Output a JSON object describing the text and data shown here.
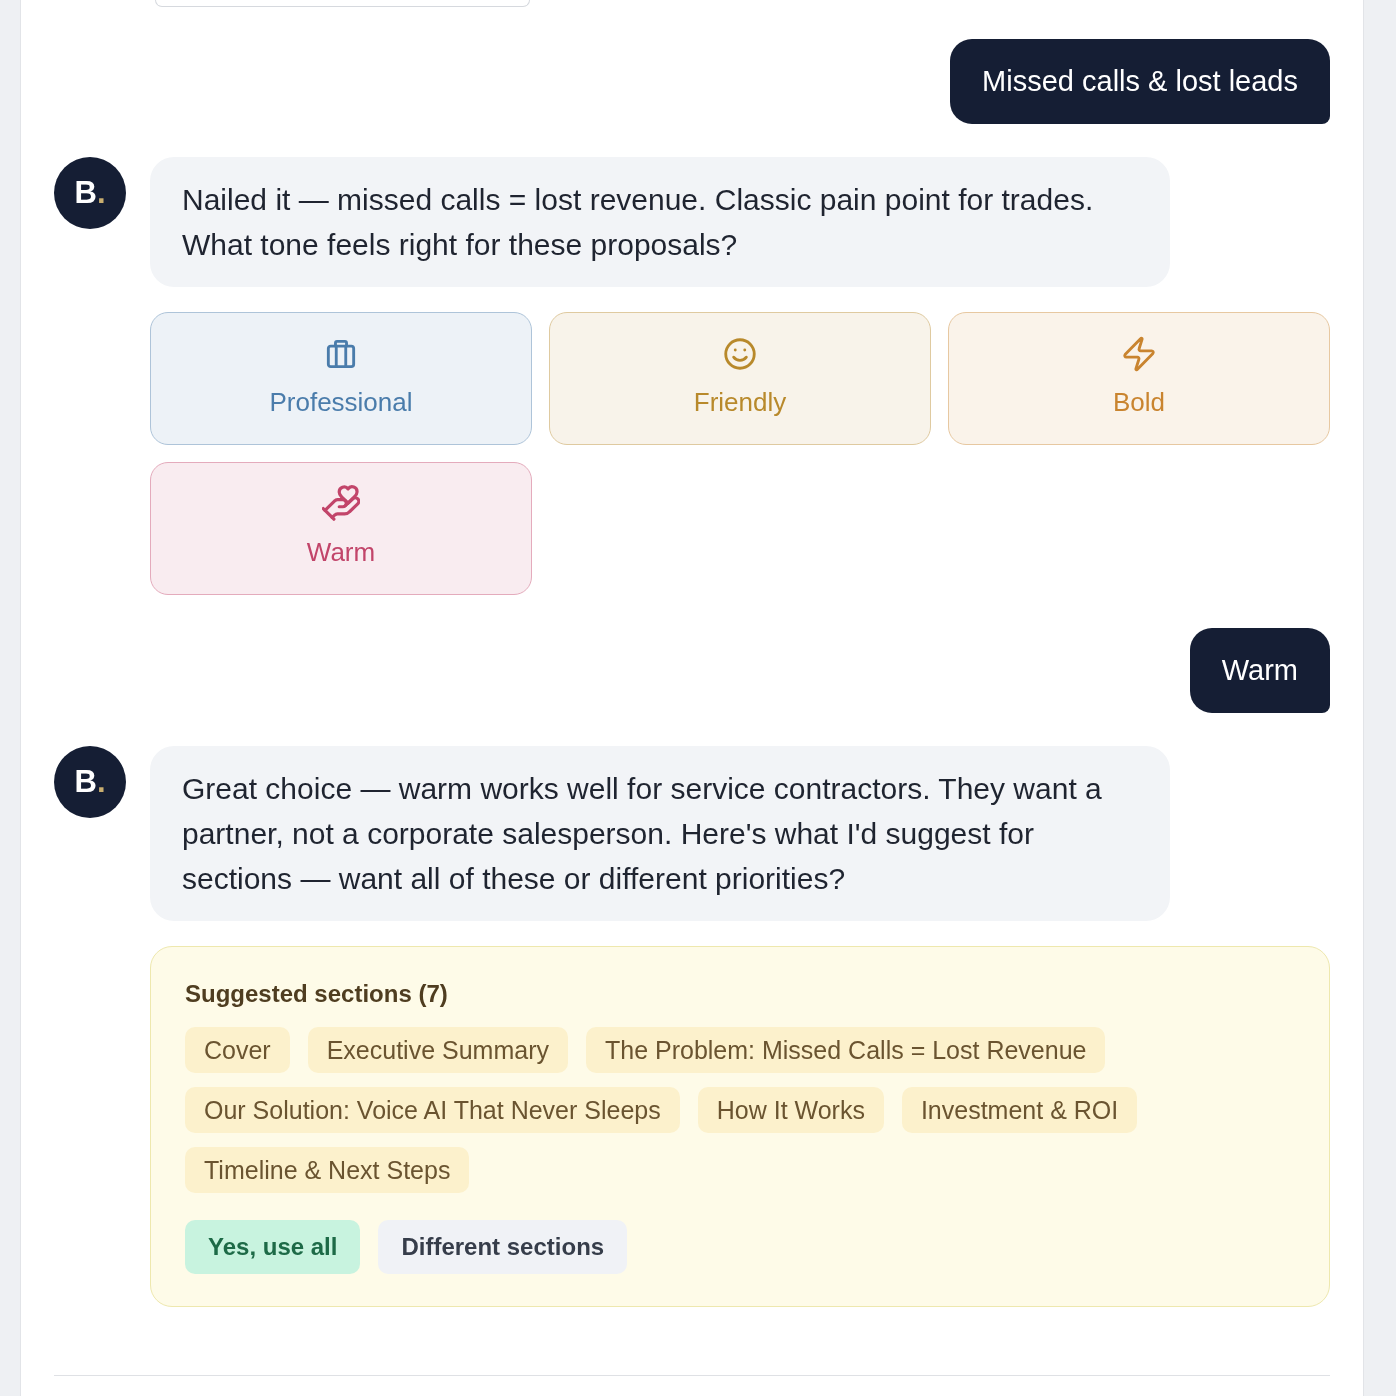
{
  "messages": [
    {
      "kind": "user",
      "text": "Missed calls & lost leads"
    },
    {
      "kind": "bot",
      "avatar": {
        "letter": "B",
        "accent": "."
      },
      "text": "Nailed it — missed calls = lost revenue. Classic pain point for trades. What tone feels right for these proposals?",
      "tone_options": [
        {
          "label": "Professional",
          "color": "#4a7cab"
        },
        {
          "label": "Friendly",
          "color": "#b8892b"
        },
        {
          "label": "Bold",
          "color": "#c9842f"
        },
        {
          "label": "Warm",
          "color": "#c2456a"
        }
      ]
    },
    {
      "kind": "user",
      "text": "Warm"
    },
    {
      "kind": "bot",
      "avatar": {
        "letter": "B",
        "accent": "."
      },
      "text": "Great choice — warm works well for service contractors. They want a partner, not a corporate salesperson. Here's what I'd suggest for sections — want all of these or different priorities?",
      "sections_card": {
        "title": "Suggested sections (7)",
        "sections": [
          "Cover",
          "Executive Summary",
          "The Problem: Missed Calls = Lost Revenue",
          "Our Solution: Voice AI That Never Sleeps",
          "How It Works",
          "Investment & ROI",
          "Timeline & Next Steps"
        ],
        "actions": [
          {
            "label": "Yes, use all",
            "kind": "primary"
          },
          {
            "label": "Different sections",
            "kind": "secondary"
          }
        ]
      }
    }
  ]
}
